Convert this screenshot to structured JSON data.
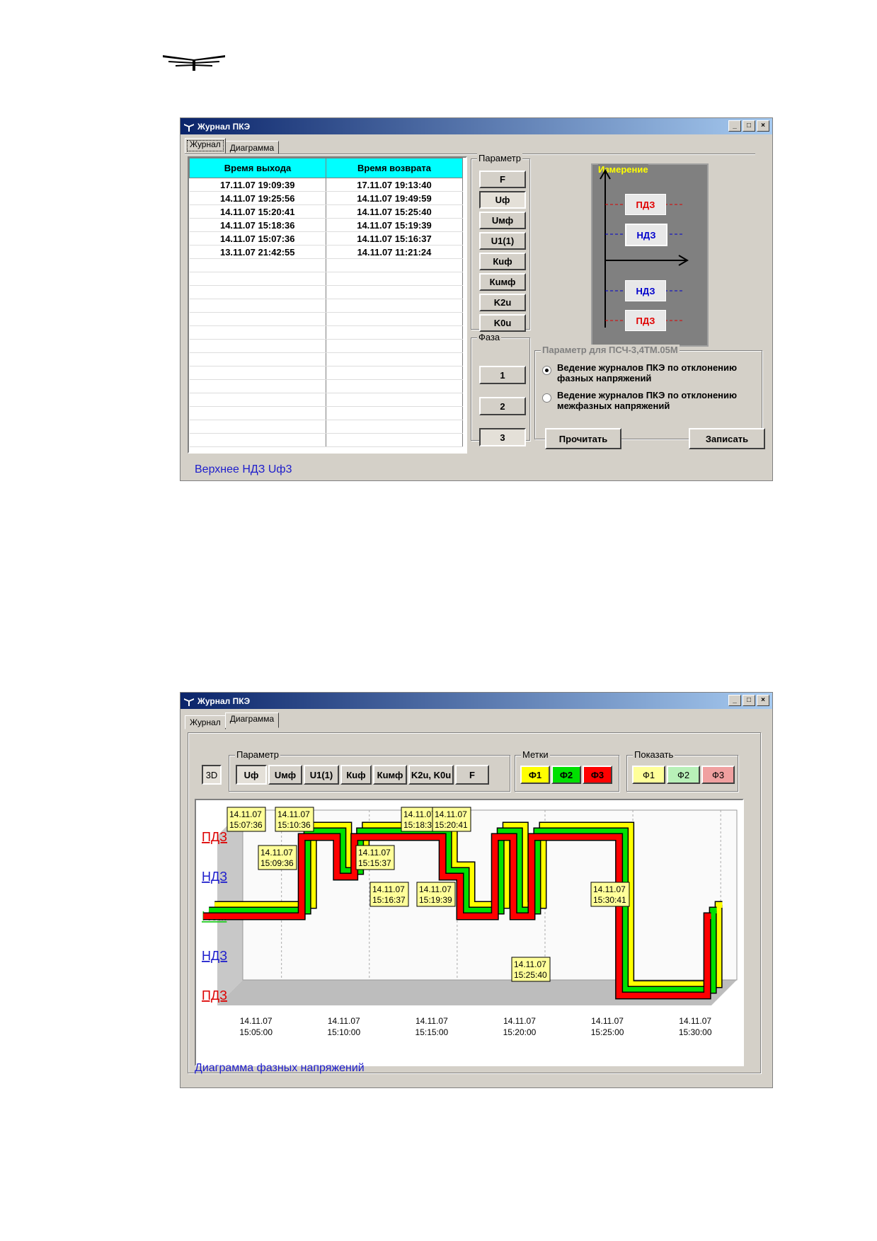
{
  "window1": {
    "title": "Журнал ПКЭ",
    "tabs": [
      "Журнал",
      "Диаграмма"
    ],
    "table": {
      "headers": [
        "Время выхода",
        "Время возврата"
      ],
      "rows": [
        [
          "17.11.07 19:09:39",
          "17.11.07 19:13:40"
        ],
        [
          "14.11.07 19:25:56",
          "14.11.07 19:49:59"
        ],
        [
          "14.11.07 15:20:41",
          "14.11.07 15:25:40"
        ],
        [
          "14.11.07 15:18:36",
          "14.11.07 15:19:39"
        ],
        [
          "14.11.07 15:07:36",
          "14.11.07 15:16:37"
        ],
        [
          "13.11.07 21:42:55",
          "14.11.07 11:21:24"
        ]
      ],
      "empty_rows": 14
    },
    "param_group": {
      "title": "Параметр",
      "buttons": [
        "F",
        "Uф",
        "Uмф",
        "U1(1)",
        "Кuф",
        "Кuмф",
        "K2u",
        "K0u"
      ],
      "selected": "Uф"
    },
    "phase_group": {
      "title": "Фаза",
      "buttons": [
        "1",
        "2",
        "3"
      ],
      "selected": "3"
    },
    "measure": {
      "title": "Измерение",
      "upper_red": "ПДЗ",
      "upper_blue": "НДЗ",
      "lower_blue": "НДЗ",
      "lower_red": "ПДЗ"
    },
    "psch_group": {
      "title": "Параметр для ПСЧ-3,4ТМ.05М",
      "option1": "Ведение журналов ПКЭ по отклонению фазных напряжений",
      "option2": "Ведение журналов ПКЭ по отклонению межфазных напряжений",
      "read_button": "Прочитать",
      "write_button": "Записать"
    },
    "status": "Верхнее НДЗ Uф3"
  },
  "window2": {
    "title": "Журнал ПКЭ",
    "tabs": [
      "Журнал",
      "Диаграмма"
    ],
    "btn3d": "3D",
    "param_group": {
      "title": "Параметр",
      "buttons": [
        "Uф",
        "Uмф",
        "U1(1)",
        "Кuф",
        "Кuмф",
        "K2u, K0u",
        "F"
      ],
      "selected": "Uф"
    },
    "marks_group": {
      "title": "Метки",
      "buttons": [
        "Ф1",
        "Ф2",
        "Ф3"
      ]
    },
    "show_group": {
      "title": "Показать",
      "buttons": [
        "Ф1",
        "Ф2",
        "Ф3"
      ]
    },
    "status": "Диаграмма фазных напряжений",
    "colors": {
      "phase1": "#ffff00",
      "phase2": "#00e000",
      "phase3": "#ff0000"
    }
  },
  "chart_data": {
    "type": "line",
    "y_levels": [
      "ПДЗ",
      "НДЗ",
      "Ном",
      "НДЗ",
      "ПДЗ"
    ],
    "x_ticks": [
      {
        "date": "14.11.07",
        "time": "15:05:00"
      },
      {
        "date": "14.11.07",
        "time": "15:10:00"
      },
      {
        "date": "14.11.07",
        "time": "15:15:00"
      },
      {
        "date": "14.11.07",
        "time": "15:20:00"
      },
      {
        "date": "14.11.07",
        "time": "15:25:00"
      },
      {
        "date": "14.11.07",
        "time": "15:30:00"
      }
    ],
    "series": [
      {
        "name": "Ф1"
      },
      {
        "name": "Ф2"
      },
      {
        "name": "Ф3"
      }
    ],
    "marks": [
      {
        "date": "14.11.07",
        "time": "15:07:36"
      },
      {
        "date": "14.11.07",
        "time": "15:10:36"
      },
      {
        "date": "14.11.07",
        "time": "15:09:36"
      },
      {
        "date": "14.11.07",
        "time": "15:15:37"
      },
      {
        "date": "14.11.07",
        "time": "15:18:3"
      },
      {
        "date": "14.11.07",
        "time": "15:20:41"
      },
      {
        "date": "14.11.07",
        "time": "15:16:37"
      },
      {
        "date": "14.11.07",
        "time": "15:19:39"
      },
      {
        "date": "14.11.07",
        "time": "15:30:41"
      },
      {
        "date": "14.11.07",
        "time": "15:25:40"
      }
    ],
    "path": [
      {
        "t": "15:02:00",
        "level": "Ном"
      },
      {
        "t": "15:07:36",
        "level": "ПДЗ верх"
      },
      {
        "t": "15:09:36",
        "level": "НДЗ верх"
      },
      {
        "t": "15:10:36",
        "level": "ПДЗ верх"
      },
      {
        "t": "15:15:37",
        "level": "НДЗ верх"
      },
      {
        "t": "15:16:37",
        "level": "Ном"
      },
      {
        "t": "15:18:36",
        "level": "ПДЗ верх"
      },
      {
        "t": "15:19:39",
        "level": "Ном"
      },
      {
        "t": "15:20:41",
        "level": "ПДЗ верх"
      },
      {
        "t": "15:25:40",
        "level": "ПДЗ низ"
      },
      {
        "t": "15:30:41",
        "level": "Ном"
      }
    ]
  }
}
